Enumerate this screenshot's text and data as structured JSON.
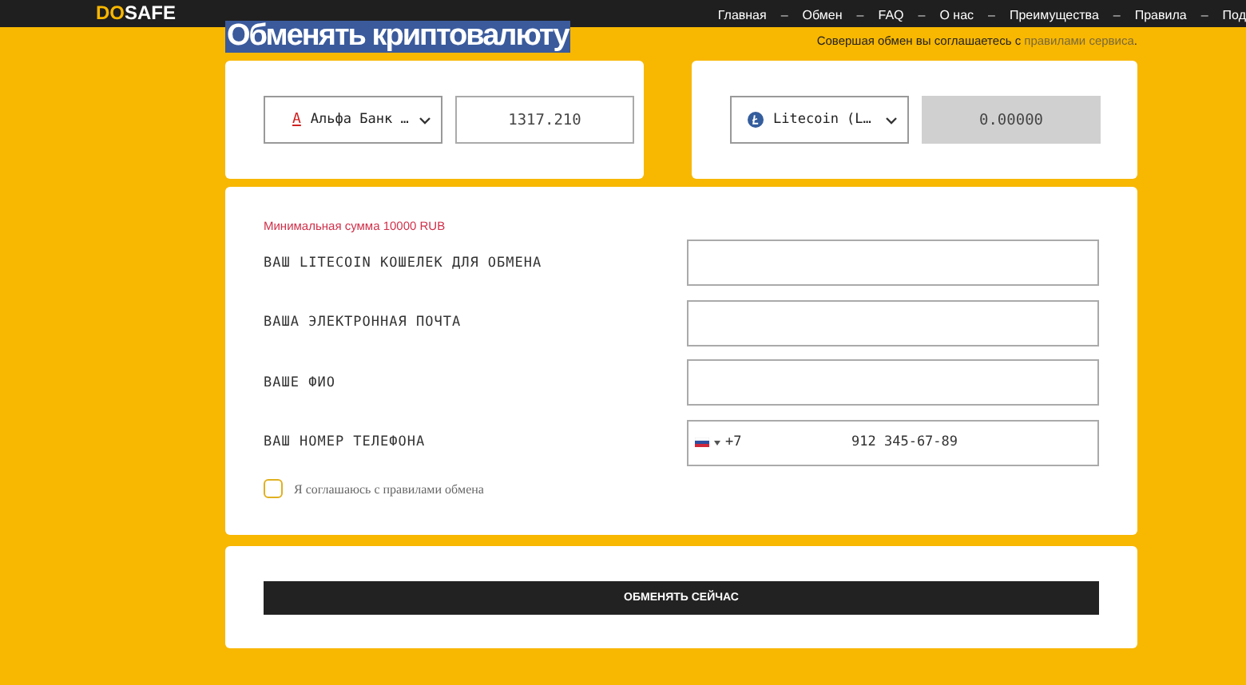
{
  "header": {
    "logo_accent": "DO",
    "logo_rest": "SAFE",
    "nav": [
      "Главная",
      "Обмен",
      "FAQ",
      "О нас",
      "Преимущества",
      "Правила",
      "Под"
    ],
    "separator": "–"
  },
  "title": {
    "text": "Обменять криптовалюту",
    "selected": true
  },
  "agreement": {
    "before": "Совершая обмен вы соглашаетесь с ",
    "link": "правилами сервиса",
    "after": "."
  },
  "send": {
    "logo": "А",
    "currency": "Альфа Банк …",
    "amount": "1317.210"
  },
  "receive": {
    "currency": "Litecoin (L…",
    "amount": "0.00000"
  },
  "form": {
    "notice": "Минимальная сумма 10000 RUB",
    "fields": [
      {
        "label": "ВАШ LITECOIN КОШЕЛЕК ДЛЯ ОБМЕНА",
        "kind": "text"
      },
      {
        "label": "ВАША ЭЛЕКТРОННАЯ ПОЧТА",
        "kind": "text"
      },
      {
        "label": "ВАШЕ ФИО",
        "kind": "text"
      },
      {
        "label": "ВАШ НОМЕР ТЕЛЕФОНА",
        "kind": "phone",
        "code": "+7",
        "value": "912 345-67-89"
      }
    ],
    "consent": {
      "label": "Я соглашаюсь с правилами обмена",
      "checked": false
    }
  },
  "submit": "ОБМЕНЯТЬ СЕЙЧАС"
}
